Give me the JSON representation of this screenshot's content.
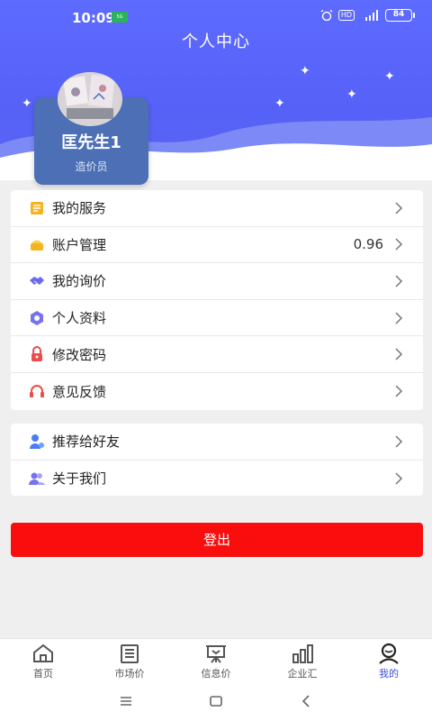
{
  "status_bar": {
    "time": "10:09",
    "chip_label": "5G",
    "hd_label": "HD",
    "signal_label": "5G",
    "battery": "84"
  },
  "header": {
    "title": "个人中心"
  },
  "profile": {
    "name": "匡先生1",
    "role": "造价员"
  },
  "menu_group_1": [
    {
      "label": "我的服务",
      "value": "",
      "icon": "service-doc-icon",
      "color": "#f5b323"
    },
    {
      "label": "账户管理",
      "value": "0.96",
      "icon": "wallet-icon",
      "color": "#f5c21b"
    },
    {
      "label": "我的询价",
      "value": "",
      "icon": "handshake-icon",
      "color": "#6b6bf2"
    },
    {
      "label": "个人资料",
      "value": "",
      "icon": "profile-gear-icon",
      "color": "#7773ef"
    },
    {
      "label": "修改密码",
      "value": "",
      "icon": "lock-icon",
      "color": "#ef4b4b"
    },
    {
      "label": "意见反馈",
      "value": "",
      "icon": "headset-icon",
      "color": "#ef4b4b"
    }
  ],
  "menu_group_2": [
    {
      "label": "推荐给好友",
      "value": "",
      "icon": "share-user-icon",
      "color": "#4b7cf5"
    },
    {
      "label": "关于我们",
      "value": "",
      "icon": "users-icon",
      "color": "#7773ef"
    }
  ],
  "logout_label": "登出",
  "tabs": [
    {
      "label": "首页",
      "icon": "home-icon",
      "active": false
    },
    {
      "label": "市场价",
      "icon": "list-doc-icon",
      "active": false
    },
    {
      "label": "信息价",
      "icon": "board-icon",
      "active": false
    },
    {
      "label": "企业汇",
      "icon": "bar-chart-icon",
      "active": false
    },
    {
      "label": "我的",
      "icon": "user-icon",
      "active": true
    }
  ],
  "colors": {
    "header_blue": "#5661f7",
    "card_blue": "#4c6fb5",
    "logout_red": "#fa0d0d",
    "active_tab": "#3d4fd6"
  }
}
